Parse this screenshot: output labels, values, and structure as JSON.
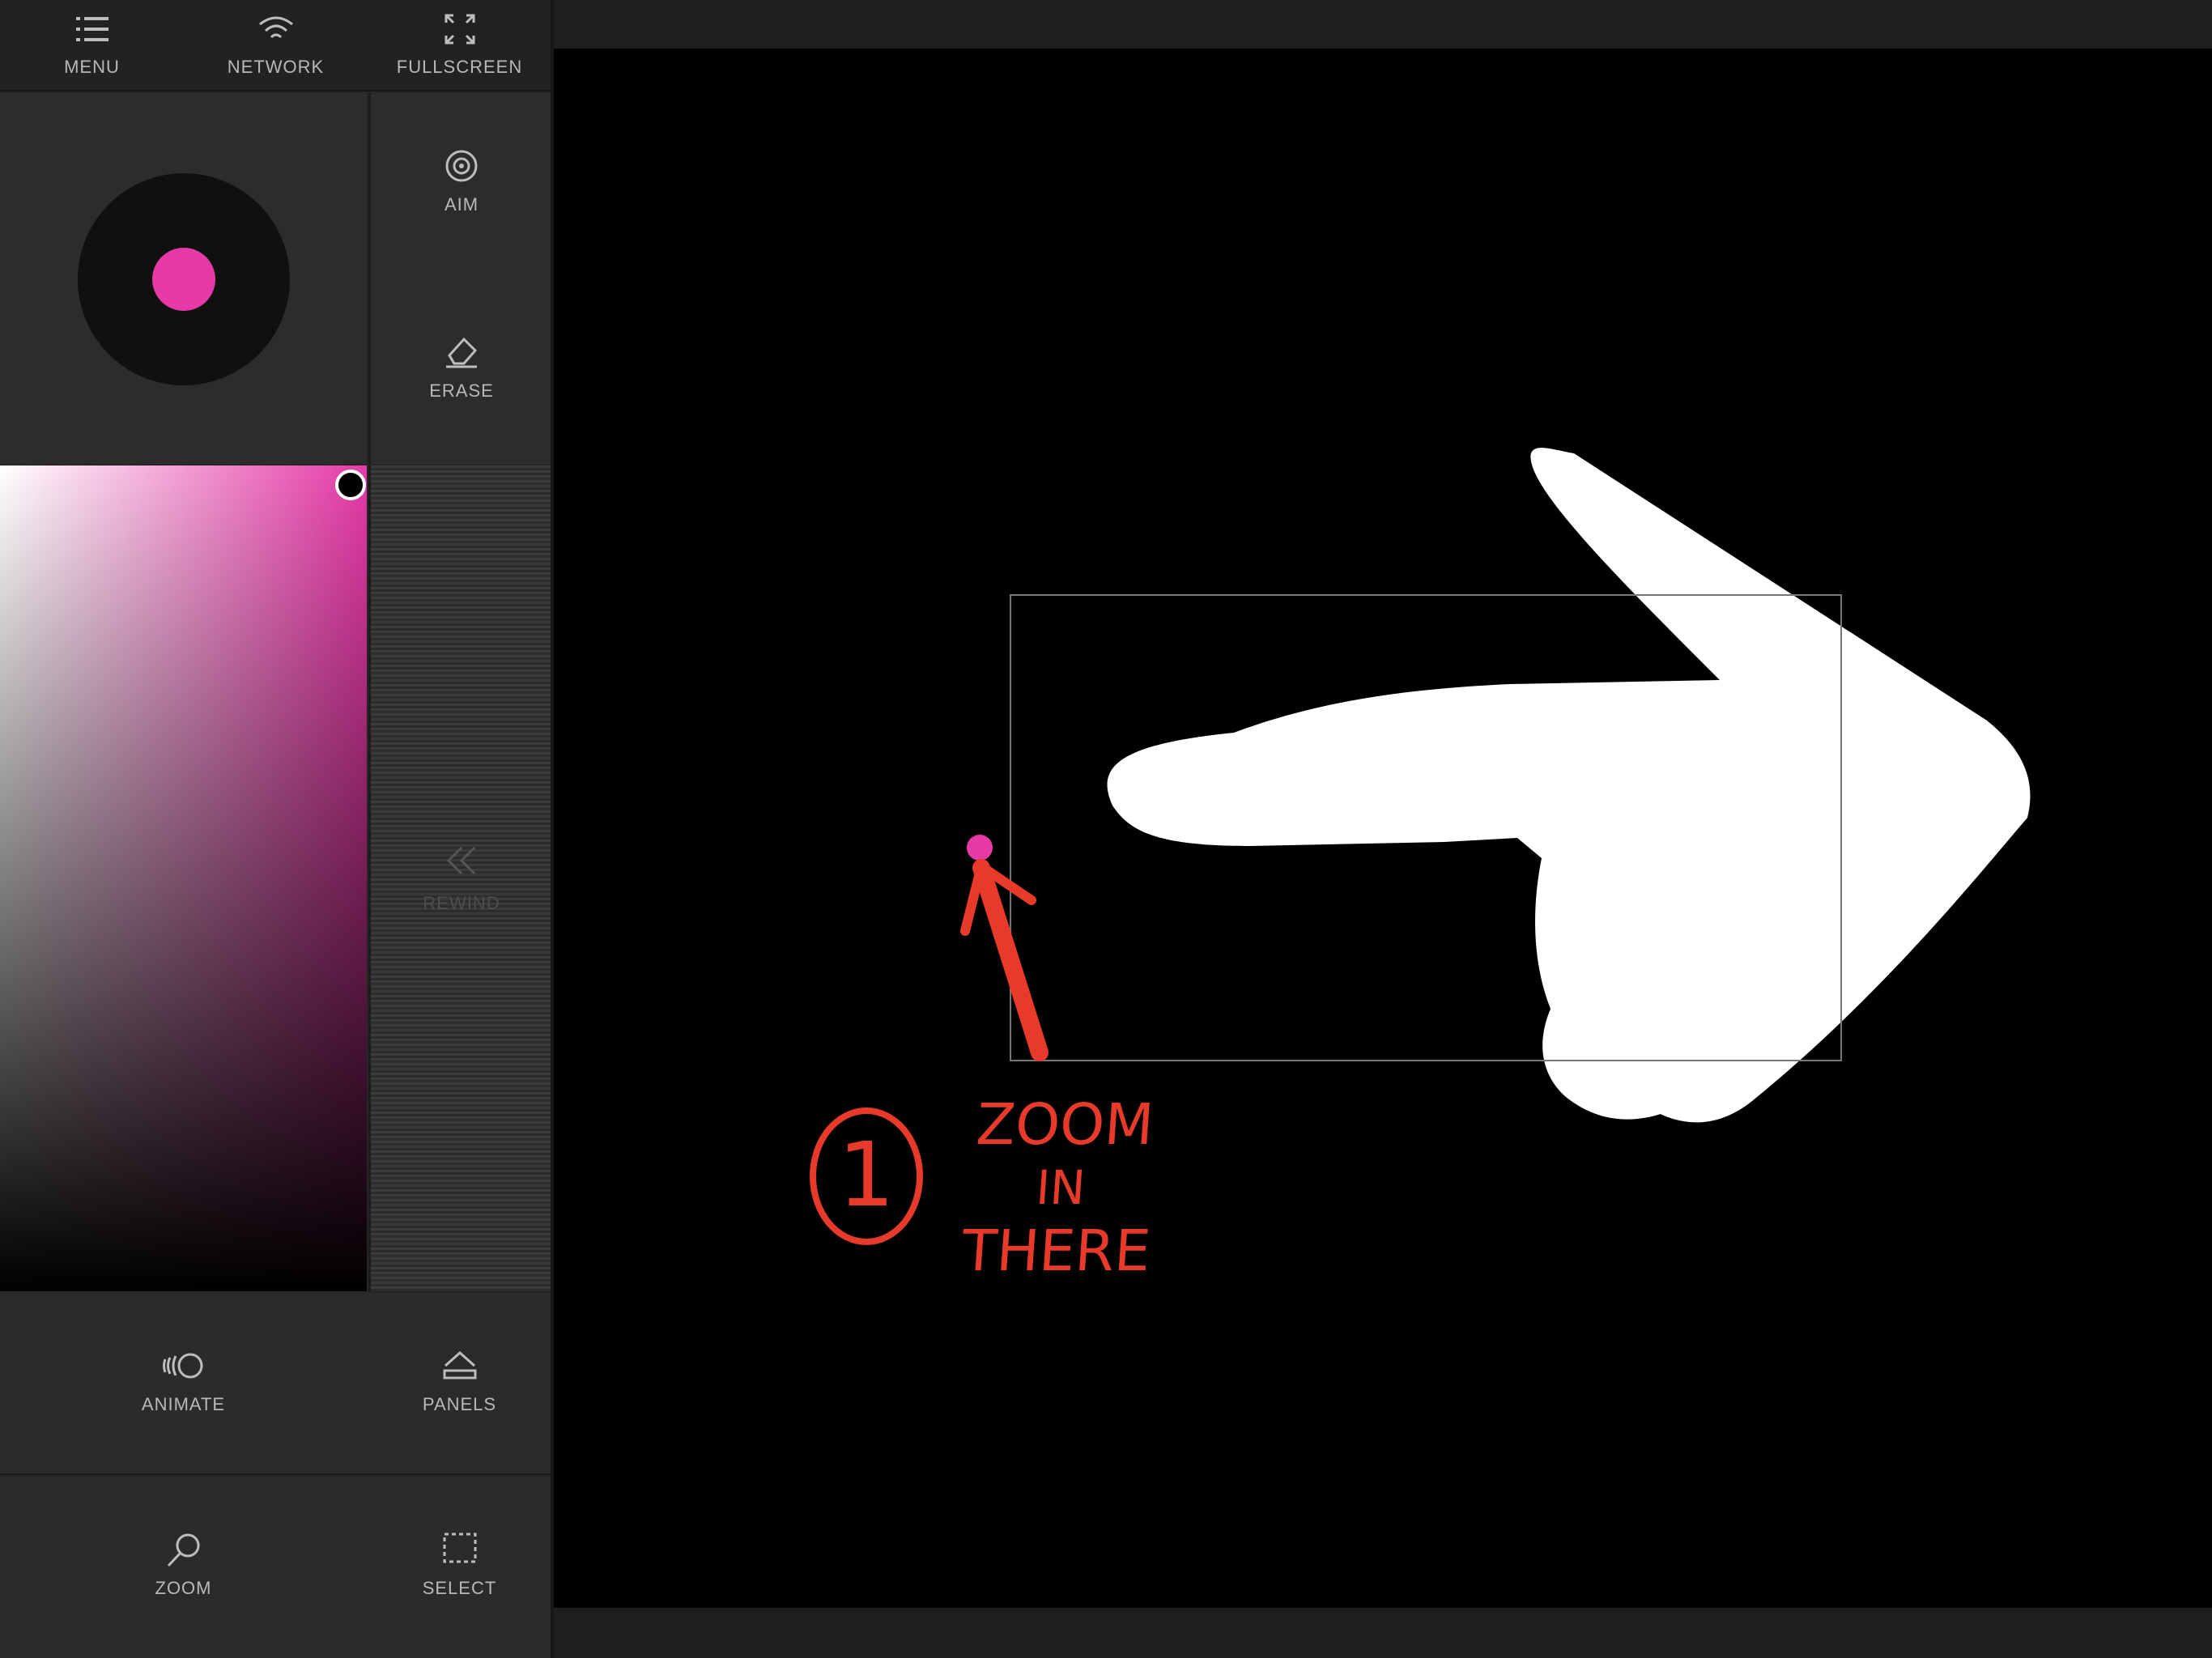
{
  "top_bar": {
    "menu_label": "MENU",
    "network_label": "NETWORK",
    "fullscreen_label": "FULLSCREEN"
  },
  "tools": {
    "aim_label": "AIM",
    "erase_label": "ERASE",
    "rewind_label": "REWIND"
  },
  "bottom": {
    "animate_label": "ANIMATE",
    "panels_label": "PANELS",
    "zoom_label": "ZOOM",
    "select_label": "SELECT"
  },
  "annotation": {
    "number": "1",
    "line1": "ZOOM",
    "line2": "IN",
    "line3": "THERE"
  },
  "colors": {
    "brush": "#e63aa7",
    "annotation": "#e83a2a",
    "canvas": "#000000"
  },
  "icons": {
    "menu": "list-icon",
    "network": "wifi-icon",
    "fullscreen": "expand-icon",
    "aim": "target-icon",
    "erase": "eraser-icon",
    "rewind": "double-chevron-left-icon",
    "animate": "animate-icon",
    "panels": "panels-icon",
    "zoom": "magnifier-icon",
    "select": "marquee-icon"
  }
}
